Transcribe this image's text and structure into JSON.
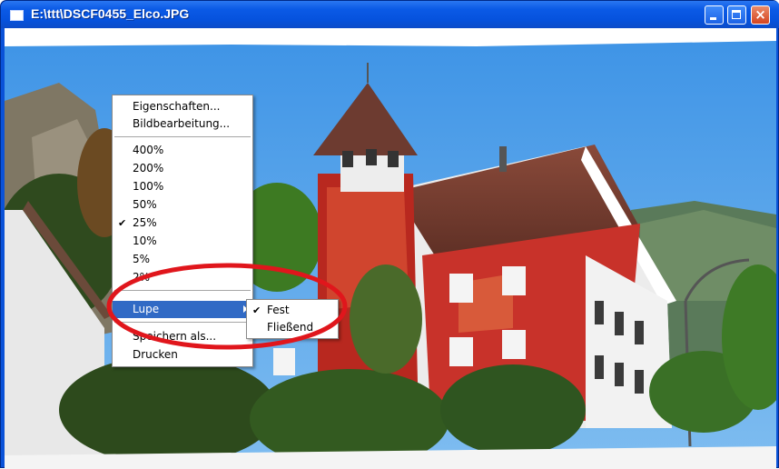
{
  "window": {
    "title": "E:\\ttt\\DSCF0455_Elco.JPG",
    "buttons": {
      "minimize": "minimize",
      "maximize": "maximize",
      "close": "×"
    }
  },
  "context_menu": {
    "items": [
      {
        "label": "Eigenschaften..."
      },
      {
        "label": "Bildbearbeitung..."
      },
      {
        "label": "400%"
      },
      {
        "label": "200%"
      },
      {
        "label": "100%"
      },
      {
        "label": "50%"
      },
      {
        "label": "25%",
        "checked": true
      },
      {
        "label": "10%"
      },
      {
        "label": "5%"
      },
      {
        "label": "2%"
      },
      {
        "label": "Lupe",
        "highlighted": true,
        "has_submenu": true
      },
      {
        "label": "Speichern als..."
      },
      {
        "label": "Drucken"
      }
    ],
    "check_mark": "✔"
  },
  "submenu": {
    "items": [
      {
        "label": "Fest",
        "checked": true
      },
      {
        "label": "Fließend"
      }
    ]
  },
  "annotation": {
    "color": "#e0161c"
  },
  "colors": {
    "titlebar": "#0b5ae6",
    "menu_highlight": "#316ac5",
    "sky": "#4fa3e8"
  }
}
